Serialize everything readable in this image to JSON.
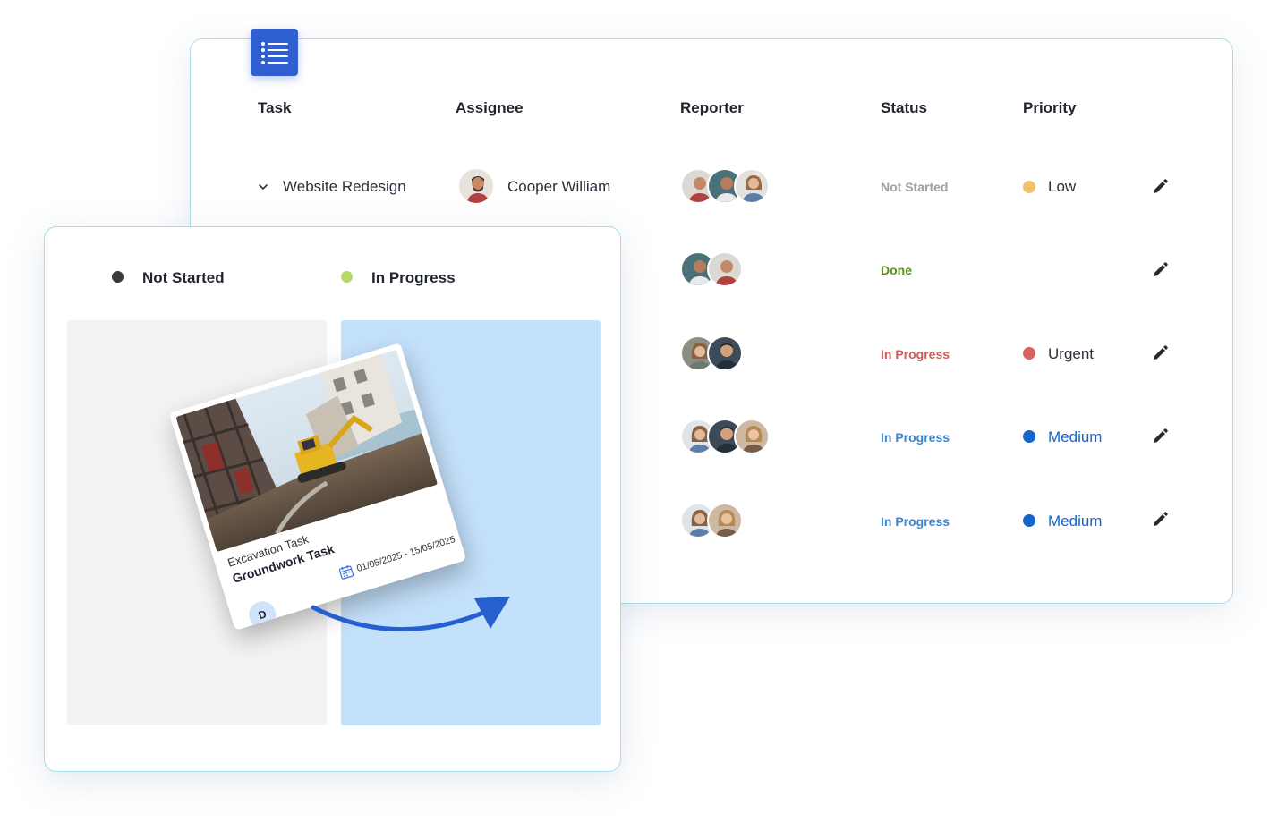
{
  "table": {
    "headers": {
      "task": "Task",
      "assignee": "Assignee",
      "reporter": "Reporter",
      "status": "Status",
      "priority": "Priority"
    },
    "rows": [
      {
        "task": "Website Redesign",
        "assignee": "Cooper William",
        "status": "Not Started",
        "status_color": "#9aa0a8",
        "priority": "Low",
        "priority_color": "#f3c06b",
        "priority_text_color": "#2a2f3a"
      },
      {
        "task": "",
        "assignee": "",
        "status": "Done",
        "status_color": "#5a8a1c",
        "priority": "",
        "priority_color": "",
        "priority_text_color": "#2a2f3a"
      },
      {
        "task": "",
        "assignee": "",
        "status": "In Progress",
        "status_color": "#cf5b5b",
        "priority": "Urgent",
        "priority_color": "#d76363",
        "priority_text_color": "#2a2f3a"
      },
      {
        "task": "",
        "assignee": "",
        "status": "In Progress",
        "status_color": "#3a86d4",
        "priority": "Medium",
        "priority_color": "#1565d0",
        "priority_text_color": "#1565d0"
      },
      {
        "task": "",
        "assignee": "",
        "status": "In Progress",
        "status_color": "#3a86d4",
        "priority": "Medium",
        "priority_color": "#1565d0",
        "priority_text_color": "#1565d0"
      }
    ]
  },
  "board": {
    "columns": [
      {
        "title": "Not Started",
        "dot_color": "#3a3a3a"
      },
      {
        "title": "In Progress",
        "dot_color": "#b7d96a"
      }
    ],
    "card": {
      "subtitle": "Excavation Task",
      "title": "Groundwork Task",
      "date_range": "01/05/2025 - 15/05/2025",
      "avatar_initial": "D"
    }
  },
  "icons": {
    "list": "list-icon",
    "expand": "chevron-down-icon",
    "edit": "pencil-icon",
    "calendar": "calendar-icon",
    "move": "curved-arrow-icon"
  }
}
